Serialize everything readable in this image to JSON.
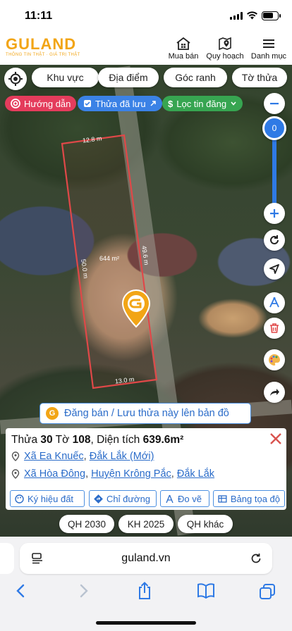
{
  "status": {
    "time": "11:11"
  },
  "header": {
    "brand": "GULAND",
    "slogan": "THÔNG TIN THẬT · GIÁ TRỊ THẬT",
    "nav": [
      {
        "label": "Mua bán",
        "icon": "house-grid-icon"
      },
      {
        "label": "Quy hoạch",
        "icon": "map-pin-icon"
      },
      {
        "label": "Danh mục",
        "icon": "menu-icon"
      }
    ]
  },
  "filters": {
    "chips": [
      "Khu vực",
      "Địa điểm",
      "Góc ranh",
      "Tờ thửa"
    ]
  },
  "pills": {
    "guide": "Hướng dẫn",
    "saved": "Thửa đã lưu",
    "filter": "Lọc tin đăng",
    "colors": {
      "guide": "#e43c5c",
      "saved": "#3b82e6",
      "filter": "#37a551"
    }
  },
  "map": {
    "opacity_value": "0",
    "parcel": {
      "top_edge": "12.8 m",
      "bottom_edge": "13.0 m",
      "left_edge": "50.0 m",
      "right_edge": "49.6 m",
      "area": "644 m²",
      "outline_color": "#e04848"
    }
  },
  "post_banner": {
    "label": "Đăng bán / Lưu thửa này lên bản đồ"
  },
  "card": {
    "title_prefix": "Thửa ",
    "parcel_no": "30",
    "title_mid": " Tờ ",
    "sheet_no": "108",
    "title_area_label": ", Diện tích ",
    "area": "639.6m²",
    "addr1": {
      "commune": "Xã Ea Knuếc",
      "province": "Đắk Lắk (Mới)"
    },
    "addr2": {
      "commune": "Xã Hòa Đông",
      "district": "Huyện Krông Pắc",
      "province": "Đắk Lắk"
    },
    "actions": [
      "Ký hiệu đất",
      "Chỉ đường",
      "Đo vẽ",
      "Bảng tọa độ"
    ]
  },
  "planning": [
    "QH 2030",
    "KH 2025",
    "QH khác"
  ],
  "browser": {
    "url": "guland.vn"
  }
}
